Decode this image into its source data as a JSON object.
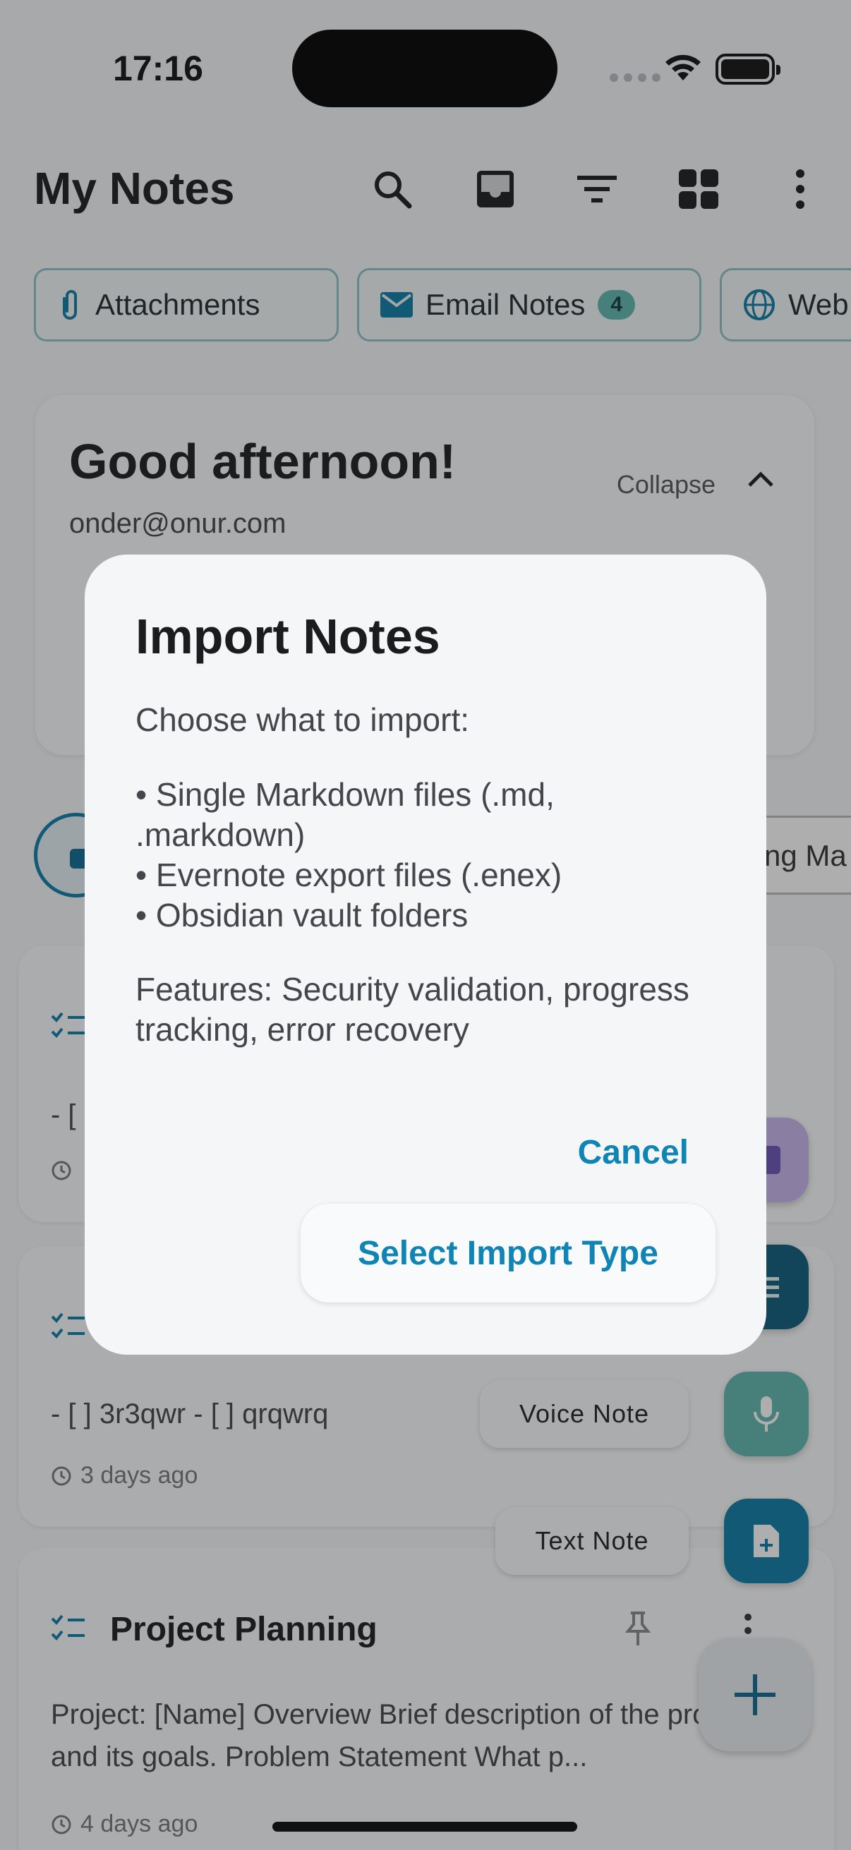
{
  "status_bar": {
    "time": "17:16"
  },
  "app_bar": {
    "title": "My Notes",
    "icons": [
      "search-icon",
      "inbox-icon",
      "filter-icon",
      "grid-view-icon",
      "more-vert-icon"
    ]
  },
  "chips": [
    {
      "icon": "paperclip-icon",
      "label": "Attachments"
    },
    {
      "icon": "mail-icon",
      "label": "Email Notes",
      "badge": "4"
    },
    {
      "icon": "globe-icon",
      "label": "Web"
    }
  ],
  "greeting": {
    "title": "Good afternoon!",
    "email": "onder@onur.com",
    "collapse_label": "Collapse"
  },
  "filter_row": {
    "partial_label": "ng Ma"
  },
  "notes": [
    {
      "title": "",
      "body": "- [",
      "time": ""
    },
    {
      "title": "",
      "body": "- [ ] 3r3qwr - [ ] qrqwrq",
      "time": "3 days ago"
    },
    {
      "title": "Project Planning",
      "body": "Project: [Name] Overview Brief description of the project and its goals. Problem Statement What p...",
      "time": "4 days ago"
    }
  ],
  "fab": {
    "voice_label": "Voice Note",
    "text_label": "Text Note"
  },
  "dialog": {
    "title": "Import Notes",
    "intro": "Choose what to import:",
    "items": [
      "• Single Markdown files (.md, .markdown)",
      "• Evernote export files (.enex)",
      "• Obsidian vault folders"
    ],
    "features": "Features: Security validation, progress tracking, error recovery",
    "cancel_label": "Cancel",
    "select_label": "Select Import Type"
  },
  "colors": {
    "accent": "#0f84b5",
    "teal": "#5fb6b0",
    "dark_teal": "#0b5b7a"
  }
}
